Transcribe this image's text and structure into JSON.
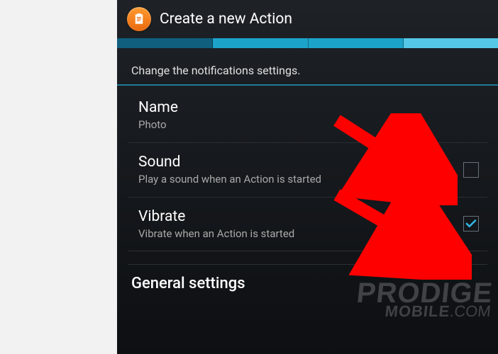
{
  "header": {
    "title": "Create a new Action",
    "icon_name": "clipboard-icon"
  },
  "progress": {
    "segments": [
      "#0f5f7d",
      "#1ca3c9",
      "#1ca3c9",
      "#55c7e6"
    ]
  },
  "subhead": "Change the notifications settings.",
  "items": [
    {
      "title": "Name",
      "subtitle": "Photo",
      "has_checkbox": false,
      "checked": false,
      "name": "setting-name"
    },
    {
      "title": "Sound",
      "subtitle": "Play a sound when an Action is started",
      "has_checkbox": true,
      "checked": false,
      "name": "setting-sound"
    },
    {
      "title": "Vibrate",
      "subtitle": "Vibrate when an Action is started",
      "has_checkbox": true,
      "checked": true,
      "name": "setting-vibrate"
    }
  ],
  "section_header": "General settings",
  "watermark": {
    "line1": "PRODIGE",
    "line2_a": "MOBILE",
    "line2_b": ".COM"
  },
  "colors": {
    "accent": "#33b5e5",
    "arrow": "#ff0000"
  }
}
